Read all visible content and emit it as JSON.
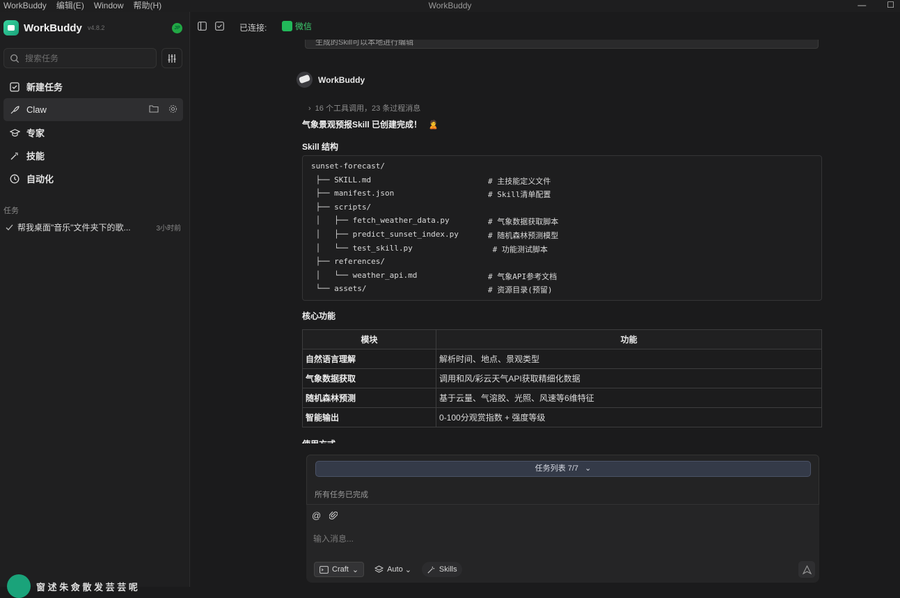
{
  "app": {
    "title": "WorkBuddy",
    "menu": [
      "WorkBuddy",
      "编辑(E)",
      "Window",
      "帮助(H)"
    ],
    "window_controls": [
      "—",
      "☐"
    ]
  },
  "sidebar": {
    "brand": "WorkBuddy",
    "version": "v4.8.2",
    "status_badge": "JP",
    "search_placeholder": "搜索任务",
    "nav": [
      {
        "label": "新建任务",
        "icon": "edit-icon"
      },
      {
        "label": "Claw",
        "icon": "claw-icon"
      },
      {
        "label": "专家",
        "icon": "graduation-cap-icon"
      },
      {
        "label": "技能",
        "icon": "magic-wand-icon"
      },
      {
        "label": "自动化",
        "icon": "clock-icon"
      }
    ],
    "section_title": "任务",
    "tasks": [
      {
        "title": "帮我桌面\"音乐\"文件夹下的歌...",
        "time": "3小时前"
      }
    ],
    "user_name": "窗 述 朱 僉 散 发 芸 芸 呢"
  },
  "topbar": {
    "connected_label": "已连接:",
    "channel": "微信"
  },
  "chat": {
    "previous_message": "生成的Skill可以本地进行编辑",
    "bot_name": "WorkBuddy",
    "tool_summary": "16 个工具调用，23 条过程消息",
    "complete_msg": "气象景观预报Skill 已创建完成！",
    "complete_emoji": "🙎",
    "structure_heading": "Skill 结构",
    "tree": [
      {
        "path": "sunset-forecast/",
        "comment": ""
      },
      {
        "path": " ├── SKILL.md",
        "comment": "# 主技能定义文件"
      },
      {
        "path": " ├── manifest.json",
        "comment": "# Skill清单配置"
      },
      {
        "path": " ├── scripts/",
        "comment": ""
      },
      {
        "path": " │   ├── fetch_weather_data.py",
        "comment": "# 气象数据获取脚本"
      },
      {
        "path": " │   ├── predict_sunset_index.py",
        "comment": "# 随机森林预测模型"
      },
      {
        "path": " │   └── test_skill.py",
        "comment": " # 功能测试脚本"
      },
      {
        "path": " ├── references/",
        "comment": ""
      },
      {
        "path": " │   └── weather_api.md",
        "comment": "# 气象API参考文档"
      },
      {
        "path": " └── assets/",
        "comment": "# 资源目录(预留)"
      }
    ],
    "core_heading": "核心功能",
    "table": {
      "headers": [
        "模块",
        "功能"
      ],
      "rows": [
        [
          "自然语言理解",
          "解析时间、地点、景观类型"
        ],
        [
          "气象数据获取",
          "调用和风/彩云天气API获取精细化数据"
        ],
        [
          "随机森林预测",
          "基于云量、气溶胶、光照、风速等6维特征"
        ],
        [
          "智能输出",
          "0-100分观赏指数 + 强度等级"
        ]
      ]
    },
    "usage_heading": "使用方式"
  },
  "composer": {
    "task_list_label": "任务列表 7/7",
    "task_status": "所有任务已完成",
    "input_placeholder": "输入消息...",
    "mode": "Craft",
    "model": "Auto",
    "skills": "Skills"
  }
}
